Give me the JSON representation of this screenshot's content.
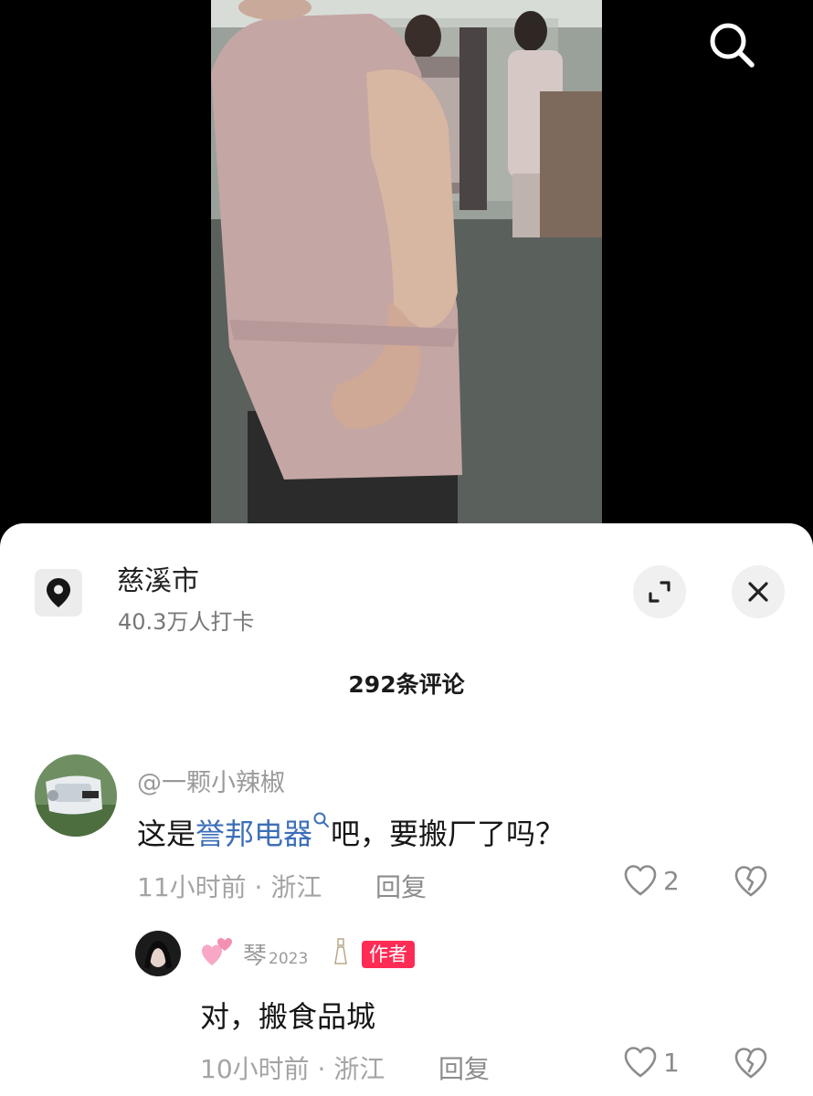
{
  "colors": {
    "background": "#000000",
    "sheet": "#ffffff",
    "link": "#3d6fb8",
    "author_badge": "#fe2c55",
    "muted_text": "#a4a4a4"
  },
  "header": {
    "search_icon": "search-icon"
  },
  "location": {
    "icon": "map-pin-icon",
    "name": "慈溪市",
    "checkins": "40.3万人打卡",
    "expand_icon": "expand-icon",
    "close_icon": "close-icon"
  },
  "comments_title": "292条评论",
  "comments": [
    {
      "username": "@一颗小辣椒",
      "text_before": "这是",
      "link_text": "誉邦电器",
      "text_after": "吧，要搬厂了吗？",
      "time_location": "11小时前 · 浙江",
      "reply_label": "回复",
      "likes": "2",
      "replies": [
        {
          "username": "琴",
          "username_deco": "2023",
          "author_badge": "作者",
          "text": "对，搬食品城",
          "time_location": "10小时前 · 浙江",
          "reply_label": "回复",
          "likes": "1"
        }
      ]
    }
  ]
}
